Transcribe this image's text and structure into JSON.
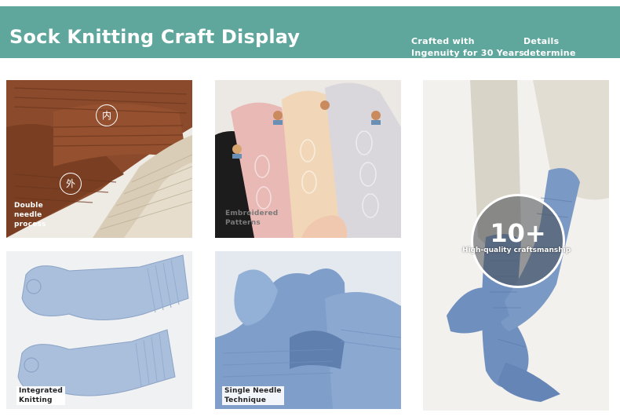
{
  "header": {
    "title": "Sock Knitting Craft Display",
    "tagline_left": "Crafted with Ingenuity for 30 Years",
    "tagline_right": "Details determine quality"
  },
  "tiles": {
    "double_needle": {
      "caption": "Double\nneedle\nprocess",
      "inner_mark": "内",
      "outer_mark": "外"
    },
    "embroidered": {
      "caption": "Embroidered\nPatterns"
    },
    "integrated": {
      "caption": "Integrated\nKnitting"
    },
    "single_needle": {
      "caption": "Single Needle\nTechnique"
    },
    "craftsmanship": {
      "badge_number": "10+",
      "badge_caption": "High-quality craftsmanship"
    }
  },
  "colors": {
    "banner": "#5fa79c",
    "brown_sock": "#8b4a2b",
    "beige_sock": "#d9cdb8",
    "blue_sock": "#a9bfdc",
    "deep_blue_sock": "#6f8fbf"
  }
}
